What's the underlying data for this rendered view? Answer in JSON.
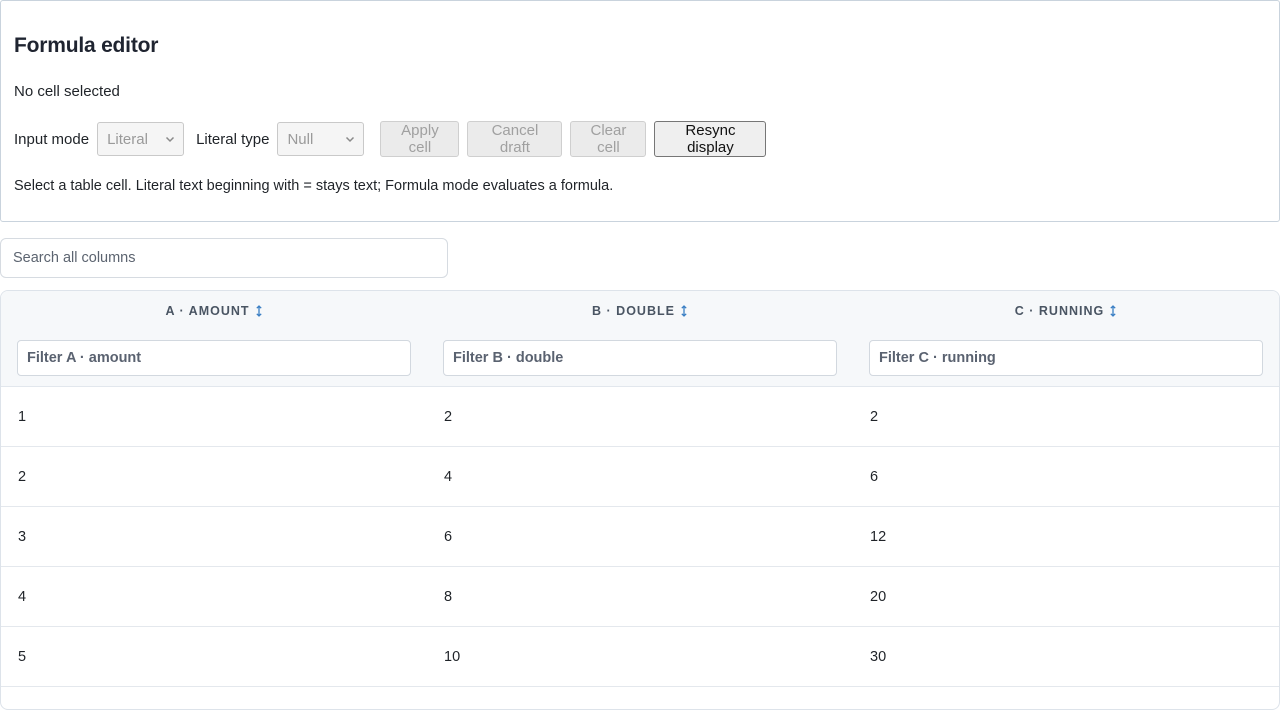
{
  "editor": {
    "title": "Formula editor",
    "status": "No cell selected",
    "input_mode_label": "Input mode",
    "input_mode_value": "Literal",
    "literal_type_label": "Literal type",
    "literal_type_value": "Null",
    "apply_label": "Apply cell",
    "cancel_label": "Cancel draft",
    "clear_label": "Clear cell",
    "resync_label": "Resync display",
    "hint": "Select a table cell. Literal text beginning with = stays text; Formula mode evaluates a formula."
  },
  "search": {
    "placeholder": "Search all columns"
  },
  "table": {
    "columns": [
      {
        "header": "A · AMOUNT",
        "filter_placeholder": "Filter A · amount"
      },
      {
        "header": "B · DOUBLE",
        "filter_placeholder": "Filter B · double"
      },
      {
        "header": "C · RUNNING",
        "filter_placeholder": "Filter C · running"
      }
    ],
    "rows": [
      [
        "1",
        "2",
        "2"
      ],
      [
        "2",
        "4",
        "6"
      ],
      [
        "3",
        "6",
        "12"
      ],
      [
        "4",
        "8",
        "20"
      ],
      [
        "5",
        "10",
        "30"
      ]
    ]
  },
  "colors": {
    "sort_icon": "#3b7fc4",
    "disabled_text": "#a0a0a0"
  }
}
